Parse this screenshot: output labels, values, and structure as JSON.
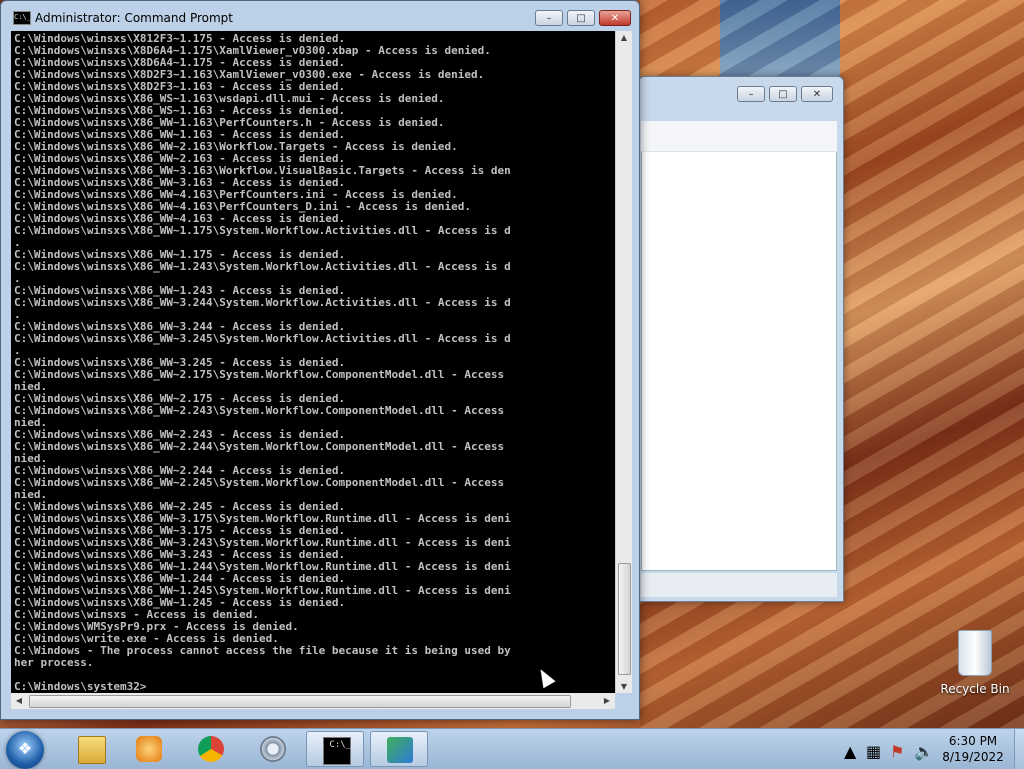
{
  "window": {
    "title": "Administrator: Command Prompt",
    "app_icon_text": "C:\\_"
  },
  "console_lines": [
    "C:\\Windows\\winsxs\\X812F3~1.175 - Access is denied.",
    "C:\\Windows\\winsxs\\X8D6A4~1.175\\XamlViewer_v0300.xbap - Access is denied.",
    "C:\\Windows\\winsxs\\X8D6A4~1.175 - Access is denied.",
    "C:\\Windows\\winsxs\\X8D2F3~1.163\\XamlViewer_v0300.exe - Access is denied.",
    "C:\\Windows\\winsxs\\X8D2F3~1.163 - Access is denied.",
    "C:\\Windows\\winsxs\\X86_WS~1.163\\wsdapi.dll.mui - Access is denied.",
    "C:\\Windows\\winsxs\\X86_WS~1.163 - Access is denied.",
    "C:\\Windows\\winsxs\\X86_WW~1.163\\PerfCounters.h - Access is denied.",
    "C:\\Windows\\winsxs\\X86_WW~1.163 - Access is denied.",
    "C:\\Windows\\winsxs\\X86_WW~2.163\\Workflow.Targets - Access is denied.",
    "C:\\Windows\\winsxs\\X86_WW~2.163 - Access is denied.",
    "C:\\Windows\\winsxs\\X86_WW~3.163\\Workflow.VisualBasic.Targets - Access is den",
    "C:\\Windows\\winsxs\\X86_WW~3.163 - Access is denied.",
    "C:\\Windows\\winsxs\\X86_WW~4.163\\PerfCounters.ini - Access is denied.",
    "C:\\Windows\\winsxs\\X86_WW~4.163\\PerfCounters_D.ini - Access is denied.",
    "C:\\Windows\\winsxs\\X86_WW~4.163 - Access is denied.",
    "C:\\Windows\\winsxs\\X86_WW~1.175\\System.Workflow.Activities.dll - Access is d",
    ".",
    "C:\\Windows\\winsxs\\X86_WW~1.175 - Access is denied.",
    "C:\\Windows\\winsxs\\X86_WW~1.243\\System.Workflow.Activities.dll - Access is d",
    ".",
    "C:\\Windows\\winsxs\\X86_WW~1.243 - Access is denied.",
    "C:\\Windows\\winsxs\\X86_WW~3.244\\System.Workflow.Activities.dll - Access is d",
    ".",
    "C:\\Windows\\winsxs\\X86_WW~3.244 - Access is denied.",
    "C:\\Windows\\winsxs\\X86_WW~3.245\\System.Workflow.Activities.dll - Access is d",
    ".",
    "C:\\Windows\\winsxs\\X86_WW~3.245 - Access is denied.",
    "C:\\Windows\\winsxs\\X86_WW~2.175\\System.Workflow.ComponentModel.dll - Access",
    "nied.",
    "C:\\Windows\\winsxs\\X86_WW~2.175 - Access is denied.",
    "C:\\Windows\\winsxs\\X86_WW~2.243\\System.Workflow.ComponentModel.dll - Access",
    "nied.",
    "C:\\Windows\\winsxs\\X86_WW~2.243 - Access is denied.",
    "C:\\Windows\\winsxs\\X86_WW~2.244\\System.Workflow.ComponentModel.dll - Access",
    "nied.",
    "C:\\Windows\\winsxs\\X86_WW~2.244 - Access is denied.",
    "C:\\Windows\\winsxs\\X86_WW~2.245\\System.Workflow.ComponentModel.dll - Access",
    "nied.",
    "C:\\Windows\\winsxs\\X86_WW~2.245 - Access is denied.",
    "C:\\Windows\\winsxs\\X86_WW~3.175\\System.Workflow.Runtime.dll - Access is deni",
    "C:\\Windows\\winsxs\\X86_WW~3.175 - Access is denied.",
    "C:\\Windows\\winsxs\\X86_WW~3.243\\System.Workflow.Runtime.dll - Access is deni",
    "C:\\Windows\\winsxs\\X86_WW~3.243 - Access is denied.",
    "C:\\Windows\\winsxs\\X86_WW~1.244\\System.Workflow.Runtime.dll - Access is deni",
    "C:\\Windows\\winsxs\\X86_WW~1.244 - Access is denied.",
    "C:\\Windows\\winsxs\\X86_WW~1.245\\System.Workflow.Runtime.dll - Access is deni",
    "C:\\Windows\\winsxs\\X86_WW~1.245 - Access is denied.",
    "C:\\Windows\\winsxs - Access is denied.",
    "C:\\Windows\\WMSysPr9.prx - Access is denied.",
    "C:\\Windows\\write.exe - Access is denied.",
    "C:\\Windows - The process cannot access the file because it is being used by",
    "her process.",
    "",
    "C:\\Windows\\system32>"
  ],
  "desktop": {
    "recycle_bin_label": "Recycle Bin"
  },
  "taskbar": {
    "items": [
      "Windows Explorer",
      "Windows Media Player",
      "Google Chrome",
      "Settings",
      "Command Prompt",
      "Package"
    ],
    "active_item": "Command Prompt",
    "time": "6:30 PM",
    "date": "8/19/2022",
    "tray_icons": [
      "show-hidden-icons",
      "network-icon",
      "action-center-icon",
      "volume-icon"
    ]
  },
  "colors": {
    "console_bg": "#000000",
    "console_fg": "#c0c0c0",
    "caption_close": "#c0392b"
  }
}
